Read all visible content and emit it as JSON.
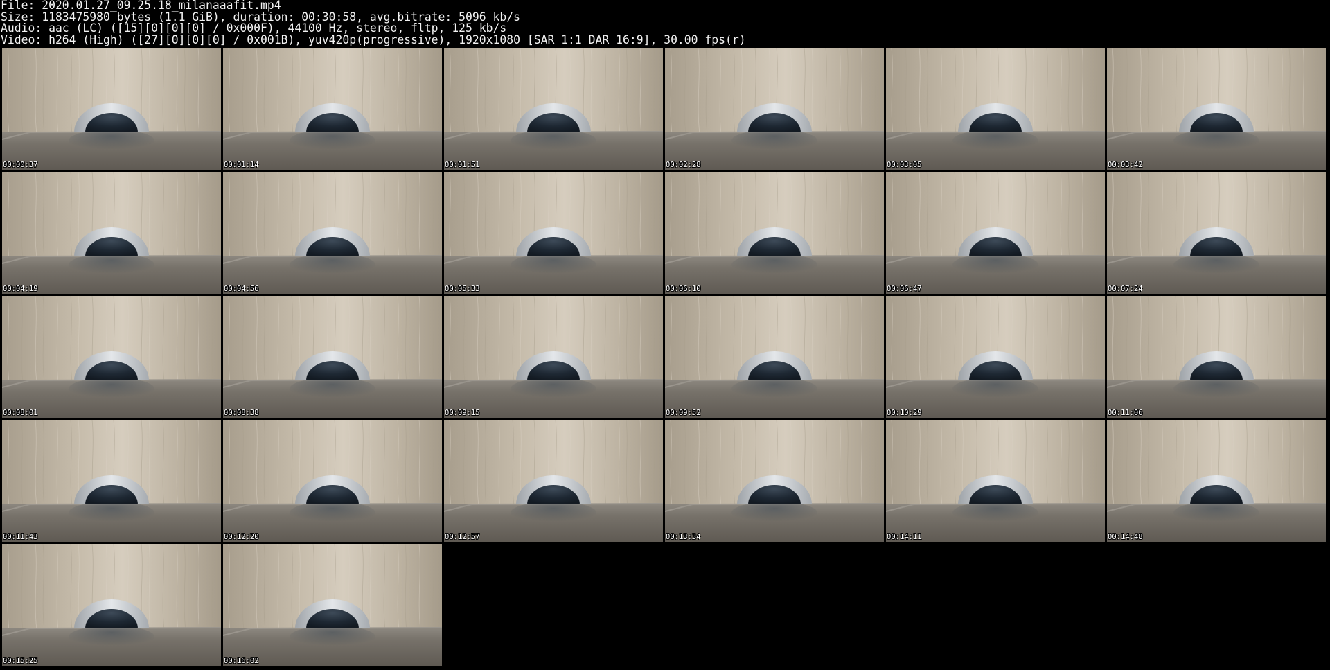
{
  "header": {
    "file_line": "File: 2020.01.27_09.25.18_milanaaafit.mp4",
    "size_line": "Size: 1183475980 bytes (1.1 GiB), duration: 00:30:58, avg.bitrate: 5096 kb/s",
    "audio_line": "Audio: aac (LC) ([15][0][0][0] / 0x000F), 44100 Hz, stereo, fltp, 125 kb/s",
    "video_line": "Video: h264 (High) ([27][0][0][0] / 0x001B), yuv420p(progressive), 1920x1080 [SAR 1:1 DAR 16:9], 30.00 fps(r)"
  },
  "columns": 6,
  "thumbnails": [
    {
      "timestamp": "00:00:37"
    },
    {
      "timestamp": "00:01:14"
    },
    {
      "timestamp": "00:01:51"
    },
    {
      "timestamp": "00:02:28"
    },
    {
      "timestamp": "00:03:05"
    },
    {
      "timestamp": "00:03:42"
    },
    {
      "timestamp": "00:04:19"
    },
    {
      "timestamp": "00:04:56"
    },
    {
      "timestamp": "00:05:33"
    },
    {
      "timestamp": "00:06:10"
    },
    {
      "timestamp": "00:06:47"
    },
    {
      "timestamp": "00:07:24"
    },
    {
      "timestamp": "00:08:01"
    },
    {
      "timestamp": "00:08:38"
    },
    {
      "timestamp": "00:09:15"
    },
    {
      "timestamp": "00:09:52"
    },
    {
      "timestamp": "00:10:29"
    },
    {
      "timestamp": "00:11:06"
    },
    {
      "timestamp": "00:11:43"
    },
    {
      "timestamp": "00:12:20"
    },
    {
      "timestamp": "00:12:57"
    },
    {
      "timestamp": "00:13:34"
    },
    {
      "timestamp": "00:14:11"
    },
    {
      "timestamp": "00:14:48"
    },
    {
      "timestamp": "00:15:25"
    },
    {
      "timestamp": "00:16:02"
    }
  ],
  "colors": {
    "background": "#000000",
    "text": "#ffffff",
    "wall": "#b8ad9b",
    "floor": "#6f6a62",
    "ring": "#c9ccd0",
    "dome": "#1f2a36"
  }
}
